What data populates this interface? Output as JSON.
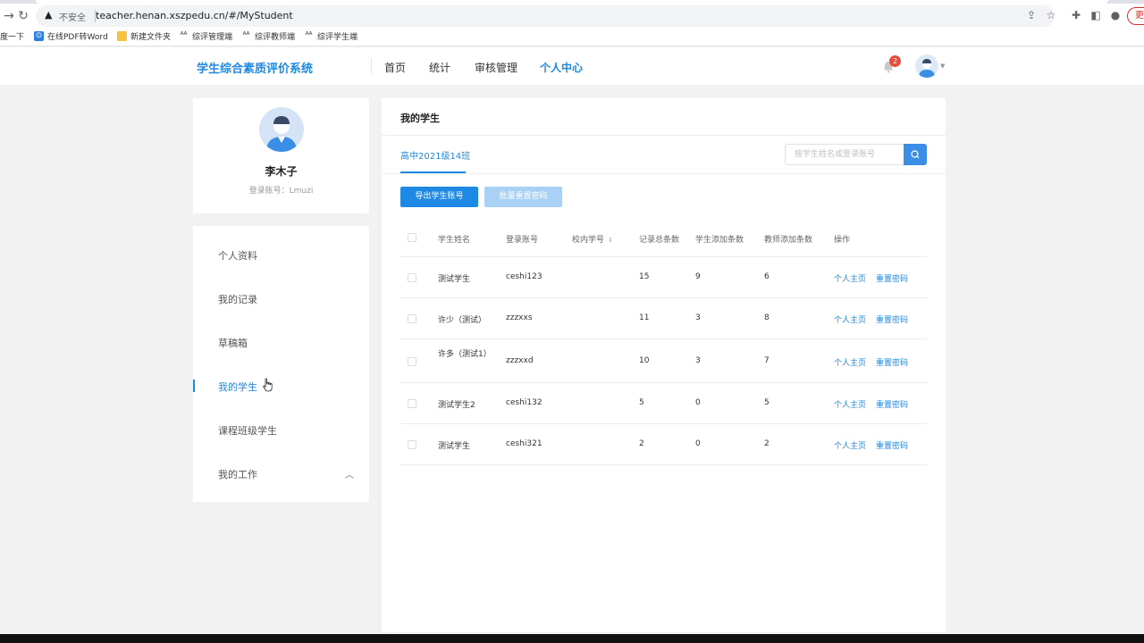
{
  "browser": {
    "insecure_label": "不安全",
    "url": "teacher.henan.xszpedu.cn/#/MyStudent",
    "update_label": "更",
    "bookmarks": [
      {
        "label": "度一下",
        "icon": "baidu-icon"
      },
      {
        "label": "在线PDF转Word",
        "icon": "pdf-icon"
      },
      {
        "label": "新建文件夹",
        "icon": "folder-icon"
      },
      {
        "label": "综评管理端",
        "icon": "bookmark-icon"
      },
      {
        "label": "综评教师端",
        "icon": "bookmark-icon"
      },
      {
        "label": "综评学生端",
        "icon": "bookmark-icon"
      }
    ]
  },
  "header": {
    "title": "学生综合素质评价系统",
    "nav": [
      "首页",
      "统计",
      "审核管理",
      "个人中心"
    ],
    "active_nav": "个人中心",
    "notification_count": "2"
  },
  "profile": {
    "name": "李木子",
    "account": "登录账号：Lmuzi"
  },
  "sidebar": {
    "items": [
      {
        "label": "个人资料"
      },
      {
        "label": "我的记录"
      },
      {
        "label": "草稿箱"
      },
      {
        "label": "我的学生"
      },
      {
        "label": "课程班级学生"
      },
      {
        "label": "我的工作"
      }
    ],
    "active": "我的学生"
  },
  "main": {
    "title": "我的学生",
    "class_tab": "高中2021级14班",
    "search_placeholder": "按学生姓名或登录账号",
    "export_button": "导出学生账号",
    "reset_button": "批量重置密码",
    "columns": [
      "学生姓名",
      "登录账号",
      "校内学号",
      "记录总条数",
      "学生添加条数",
      "教师添加条数",
      "操作"
    ],
    "rows": [
      {
        "name": "测试学生",
        "account": "ceshi123",
        "sid": "",
        "total": "15",
        "student": "9",
        "teacher": "6",
        "op1": "个人主页",
        "op2": "重置密码"
      },
      {
        "name": "许少（测试）",
        "account": "zzzxxs",
        "sid": "",
        "total": "11",
        "student": "3",
        "teacher": "8",
        "op1": "个人主页",
        "op2": "重置密码"
      },
      {
        "name": "许多（测试1）",
        "account": "zzzxxd",
        "sid": "",
        "total": "10",
        "student": "3",
        "teacher": "7",
        "op1": "个人主页",
        "op2": "重置密码"
      },
      {
        "name": "测试学生2",
        "account": "ceshi132",
        "sid": "",
        "total": "5",
        "student": "0",
        "teacher": "5",
        "op1": "个人主页",
        "op2": "重置密码"
      },
      {
        "name": "测试学生",
        "account": "ceshi321",
        "sid": "",
        "total": "2",
        "student": "0",
        "teacher": "2",
        "op1": "个人主页",
        "op2": "重置密码"
      }
    ]
  },
  "colors": {
    "accent": "#1e88e5",
    "accent_light": "#a9d0f5",
    "badge": "#e74c3c",
    "page_bg": "#f2f2f2"
  }
}
